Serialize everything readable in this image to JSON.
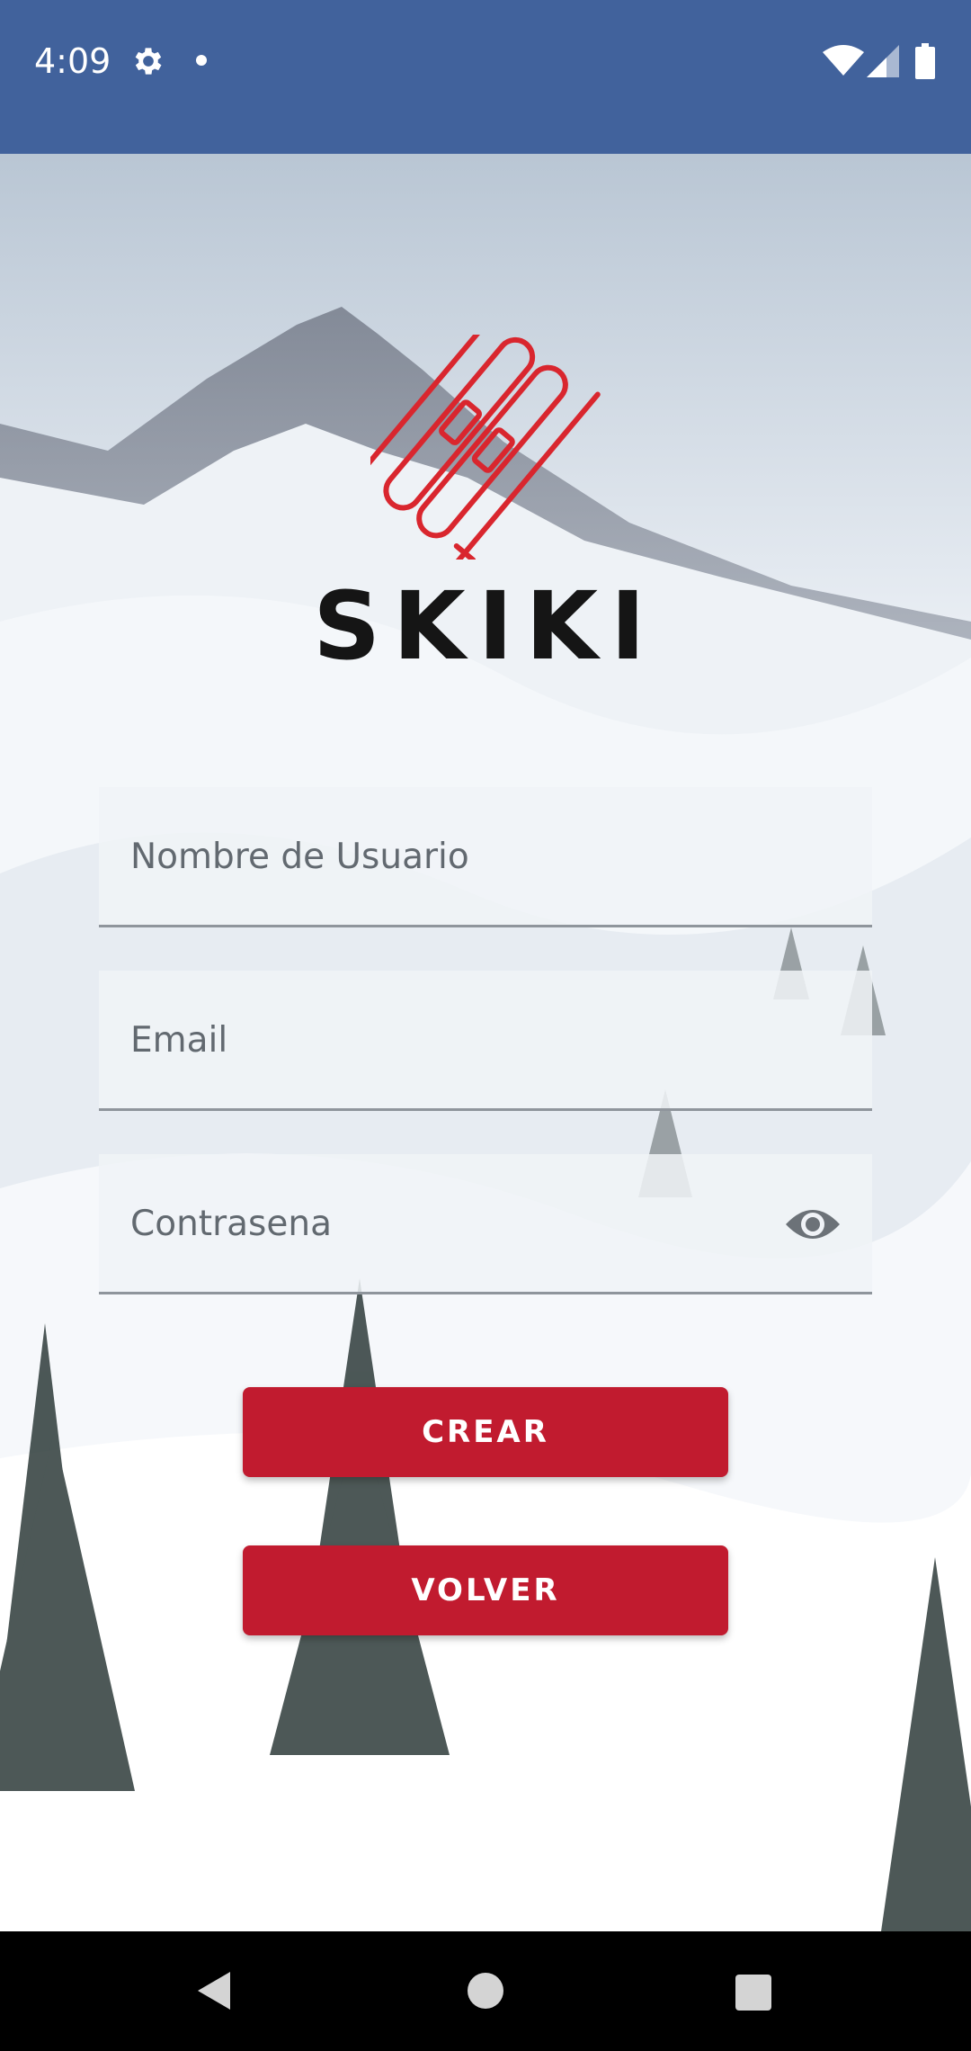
{
  "status_bar": {
    "time": "4:09",
    "icons": [
      "gear-icon",
      "notification-dot-icon",
      "wifi-icon",
      "cell-signal-icon",
      "battery-icon"
    ],
    "background_color": "#41629c"
  },
  "brand": {
    "name": "SKIKI",
    "logo_icon": "skis-and-poles-icon",
    "logo_color": "#d9262e",
    "word_color": "#151515"
  },
  "form": {
    "username": {
      "value": "",
      "placeholder": "Nombre de Usuario"
    },
    "email": {
      "value": "",
      "placeholder": "Email"
    },
    "password": {
      "value": "",
      "placeholder": "Contrasena",
      "toggle_icon": "eye-icon"
    }
  },
  "buttons": {
    "create_label": "CREAR",
    "back_label": "VOLVER",
    "color": "#c11b2f"
  },
  "nav_bar": {
    "icons": [
      "back-triangle-icon",
      "home-circle-icon",
      "recents-square-icon"
    ]
  }
}
